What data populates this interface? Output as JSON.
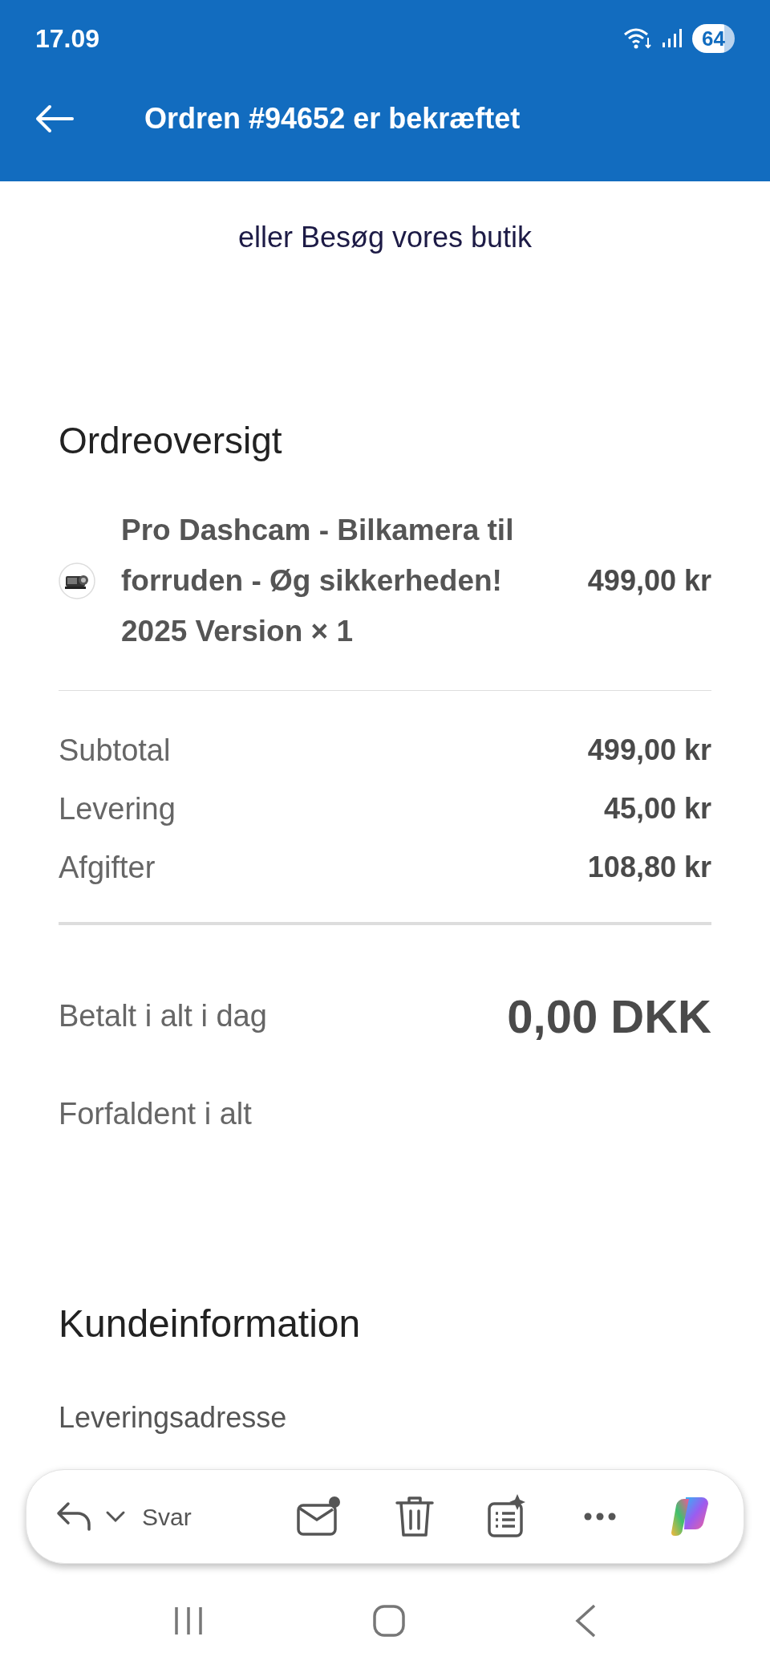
{
  "status_bar": {
    "time": "17.09",
    "battery": "64"
  },
  "header": {
    "title": "Ordren #94652 er bekræftet"
  },
  "email": {
    "store_link_text": "eller Besøg vores butik",
    "summary_heading": "Ordreoversigt",
    "items": [
      {
        "name": "Pro Dashcam - Bilkamera til forruden - Øg sikkerheden! 2025 Version × 1",
        "price": "499,00 kr"
      }
    ],
    "totals": [
      {
        "label": "Subtotal",
        "value": "499,00 kr"
      },
      {
        "label": "Levering",
        "value": "45,00 kr"
      },
      {
        "label": "Afgifter",
        "value": "108,80 kr"
      }
    ],
    "paid": {
      "label": "Betalt i alt i dag",
      "value": "0,00 DKK"
    },
    "due": {
      "label": "Forfaldent i alt"
    },
    "customer_heading": "Kundeinformation",
    "shipping_heading": "Leveringsadresse"
  },
  "toolbar": {
    "reply_label": "Svar"
  }
}
